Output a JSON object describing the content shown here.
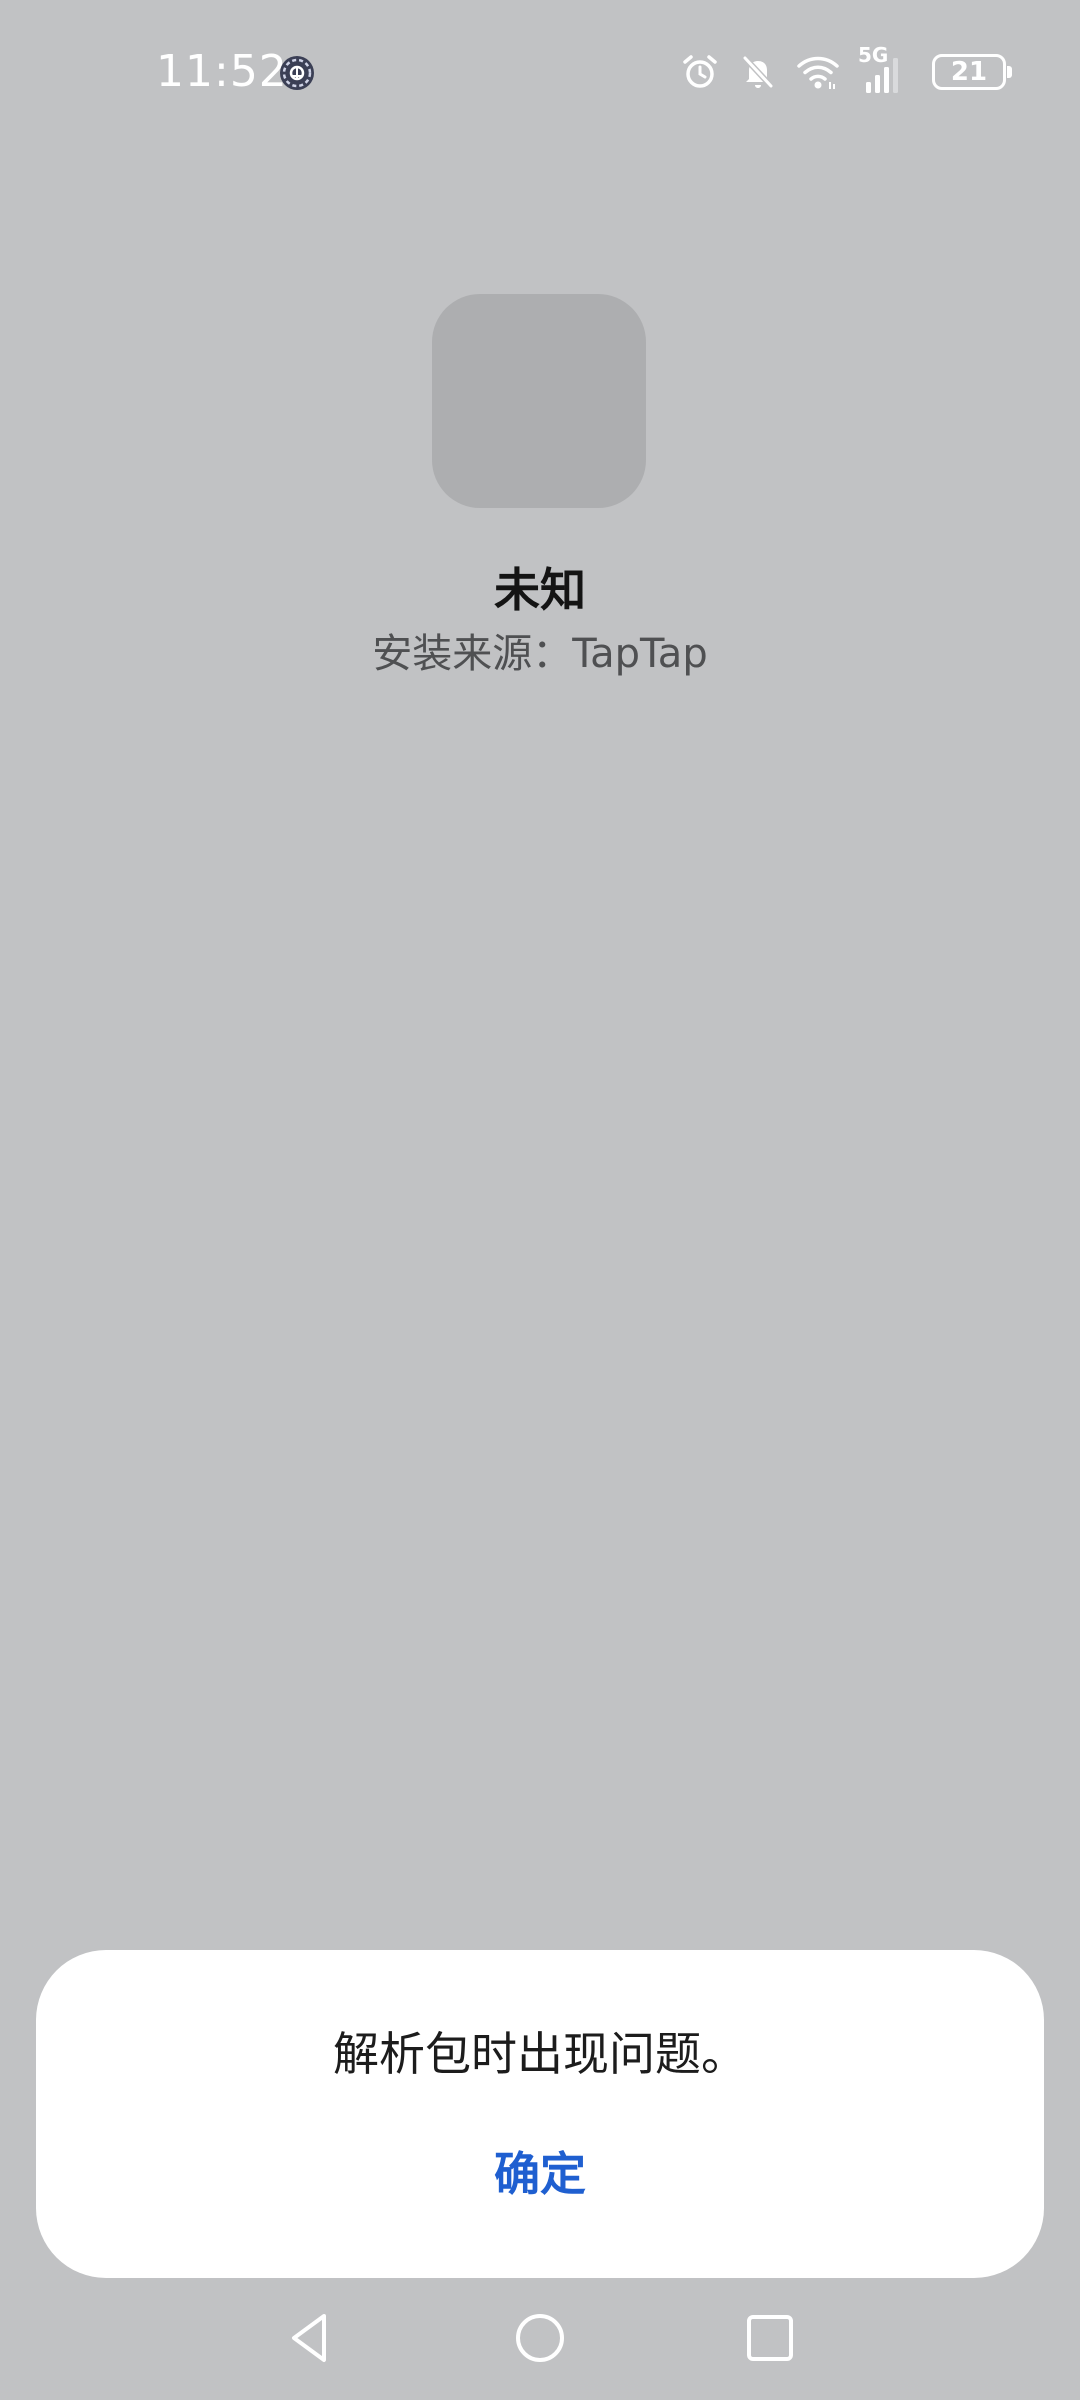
{
  "status_bar": {
    "time": "11:52",
    "network": "5G",
    "battery_level": "21",
    "icons": [
      "settings-gear-icon",
      "alarm-icon",
      "bell-muted-icon",
      "wifi-icon",
      "cellular-signal-icon",
      "battery-icon"
    ]
  },
  "app": {
    "name": "未知",
    "install_source": "安装来源：TapTap"
  },
  "dialog": {
    "message": "解析包时出现问题。",
    "confirm_label": "确定"
  },
  "navigation": {
    "icons": [
      "back-triangle-icon",
      "home-circle-icon",
      "recent-apps-square-icon"
    ]
  },
  "colors": {
    "background": "#c1c2c4",
    "dialog_background": "#ffffff",
    "accent": "#1f5fd0"
  }
}
